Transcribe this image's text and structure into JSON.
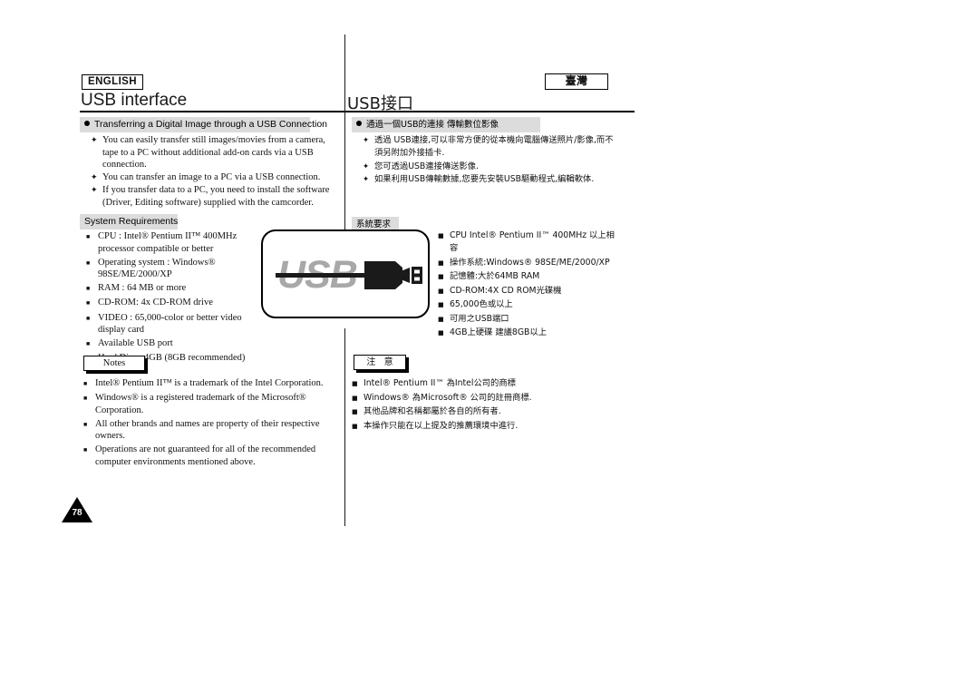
{
  "page": {
    "number": "78",
    "english_badge": "ENGLISH",
    "taiwan_badge": "臺灣",
    "title_en": "USB interface",
    "title_zh": "USB接口"
  },
  "english": {
    "transfer_heading": "Transferring a Digital Image through a USB Connection",
    "transfer_items": [
      "You can easily transfer still images/movies from a camera, tape to a PC without additional add-on cards via a USB connection.",
      "You can transfer an image to a PC via a USB connection.",
      "If you transfer data to a PC, you need to install the software (Driver, Editing software) supplied with the camcorder."
    ],
    "sysreq_heading": "System Requirements",
    "sysreq_items": [
      "CPU : Intel® Pentium II™ 400MHz processor compatible or better",
      "Operating system : Windows® 98SE/ME/2000/XP",
      "RAM : 64 MB or more",
      "CD-ROM: 4x CD-ROM drive",
      "VIDEO : 65,000-color or better video display card",
      "Available USB port",
      "Hard Disc : 4GB (8GB recommended)"
    ],
    "notes_label": "Notes",
    "notes_items": [
      "Intel® Pentium II™ is a trademark of the Intel Corporation.",
      "Windows® is a registered trademark of the Microsoft® Corporation.",
      "All other brands and names are property of their respective owners.",
      "Operations are not guaranteed for all of the recommended computer environments mentioned above."
    ]
  },
  "chinese": {
    "transfer_heading": "通過一個USB的連接 傳輸數位影像",
    "transfer_items": [
      "透過 USB連接,可以非常方便的從本機向電腦傳送照片/影像,而不須另附加外接插卡.",
      "您可透過USB連接傳送影像.",
      "如果利用USB傳輸數據,您要先安裝USB驅動程式,編輯軟体."
    ],
    "sysreq_heading": "系統要求",
    "sysreq_items": [
      "CPU Intel® Pentium II™ 400MHz 以上相容",
      "操作系統:Windows® 98SE/ME/2000/XP",
      "記憶體:大於64MB RAM",
      "CD-ROM:4X CD ROM光碟機",
      "65,000色或以上",
      "可用之USB端口",
      "4GB上硬碟 建議8GB以上"
    ],
    "notes_label": "注 意",
    "notes_items": [
      "Intel® Pentium II™ 為Intel公司的商標",
      "Windows® 為Microsoft® 公司的註冊商標.",
      "其他品牌和名稱都屬於各自的所有者.",
      "本操作只能在以上提及的推薦環境中進行."
    ]
  },
  "usb_logo": {
    "wordmark": "USB",
    "wordmark_color": "#a8a8a8",
    "connector_color": "#1a1a1a"
  }
}
